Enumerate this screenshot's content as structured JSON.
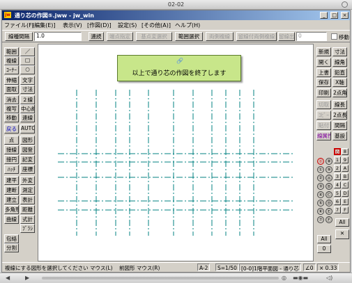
{
  "os_title": "02-02",
  "window": {
    "title": "通り芯の作図⑤.jww - jw_win",
    "icon_text": "jw"
  },
  "menu": [
    "ファイル(F)",
    "[編集(E)]",
    "表示(V)",
    "[作図(D)]",
    "設定(S)",
    "[その他(A)]",
    "ヘルプ(H)"
  ],
  "toolbar": {
    "linetype_label": "線種間隔",
    "linetype_value": "1.0",
    "buttons": [
      "連続",
      "端点指定",
      "基点変選択",
      "範囲選択",
      "両側複線",
      "留線付両側複線",
      "留線出"
    ],
    "tail_field": "0",
    "move_label": "移動"
  },
  "left_tools": [
    [
      "範囲",
      "／"
    ],
    [
      "複線",
      "□"
    ],
    [
      "ｺｰﾅｰ",
      "○"
    ],
    [
      "伸縮",
      "文字"
    ],
    [
      "面取",
      "寸法"
    ],
    [
      "消去",
      "２線"
    ],
    [
      "複写",
      "中心線"
    ],
    [
      "移動",
      "連線"
    ],
    [
      "戻る",
      "AUTO"
    ],
    [
      "点",
      "図形"
    ],
    [
      "接線",
      "図登"
    ],
    [
      "接円",
      "記変"
    ],
    [
      "ﾊｯﾁ",
      "座標"
    ],
    [
      "建平",
      "外変"
    ],
    [
      "建断",
      "測定"
    ],
    [
      "建立",
      "表計"
    ],
    [
      "多角形",
      "距離"
    ],
    [
      "曲線",
      "式計"
    ],
    [
      "",
      "ﾌﾞﾗｼ"
    ],
    [
      "包絡",
      ""
    ],
    [
      "分割",
      ""
    ]
  ],
  "right_tools": [
    [
      "新規",
      "寸法"
    ],
    [
      "開く",
      "線角"
    ],
    [
      "上書",
      "鉛直"
    ],
    [
      "保存",
      "X軸"
    ],
    [
      "印刷",
      "2点角"
    ],
    [
      "切取",
      "線長"
    ],
    [
      "ｺﾋﾟｰ",
      "2点長"
    ],
    [
      "貼付",
      "間隔"
    ],
    [
      "線属性",
      "基設"
    ]
  ],
  "message": "以上で通り芯の作図を終了します",
  "message_icon": "🔗",
  "layer_panel": {
    "active_group": "0",
    "circled": [
      "⓪",
      "⑧",
      "①",
      "⑨",
      "②",
      "Ⓐ",
      "③",
      "Ⓑ",
      "④",
      "Ⓒ",
      "⑤",
      "Ⓓ",
      "⑥",
      "Ⓔ",
      "⑦",
      "Ⓕ"
    ],
    "squared": [
      "0",
      "8",
      "1",
      "9",
      "2",
      "A",
      "3",
      "B",
      "4",
      "C",
      "5",
      "D",
      "6",
      "E",
      "7",
      "F"
    ],
    "all_label": "All",
    "cross_label": "✕",
    "all2_label": "All",
    "zero_label": "0"
  },
  "status": {
    "prompt": "複線にする図形を選択してください マウス(L)",
    "prompt2": "前図形 マウス(R)",
    "paper": "A-2",
    "scale": "S=1/50",
    "layer": "[0-0]1階平面図 - 通り芯",
    "angle": "∠0",
    "zoom": "× 0.33"
  },
  "grid": {
    "vertical_x_fractions": [
      0.14,
      0.21,
      0.28,
      0.33,
      0.4,
      0.49,
      0.56,
      0.63,
      0.68,
      0.73,
      0.78
    ],
    "horizontal_y_fractions": [
      0.5,
      0.54,
      0.61,
      0.72,
      0.76
    ]
  },
  "colors": {
    "gridline": "#008080",
    "message_bg": "#c8e68a",
    "title_grad_start": "#0a246a"
  }
}
